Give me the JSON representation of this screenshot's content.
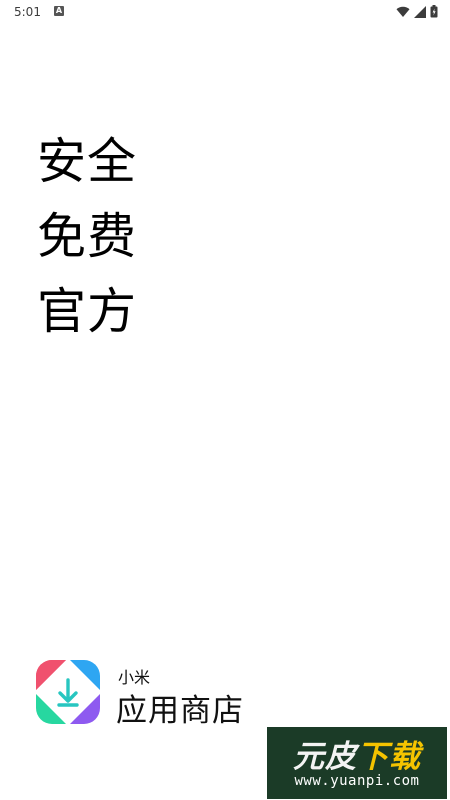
{
  "status_bar": {
    "time": "5:01",
    "notification_glyph": "A",
    "icons": [
      "wifi-icon",
      "signal-icon",
      "battery-icon"
    ]
  },
  "slogan": {
    "line1": "安全",
    "line2": "免费",
    "line3": "官方"
  },
  "brand": {
    "sub_label": "小米",
    "name": "应用商店",
    "logo_colors": {
      "top_left": "#f0516e",
      "top_right": "#2ea6f2",
      "bottom_left": "#27d7a0",
      "bottom_right": "#8e5af0",
      "arrow": "#27c6c0"
    }
  },
  "watermark": {
    "title_part1": "元皮",
    "title_part2": "下载",
    "url": "www.yuanpi.com",
    "background": "#1b3b27",
    "accent": "#f5c400"
  }
}
